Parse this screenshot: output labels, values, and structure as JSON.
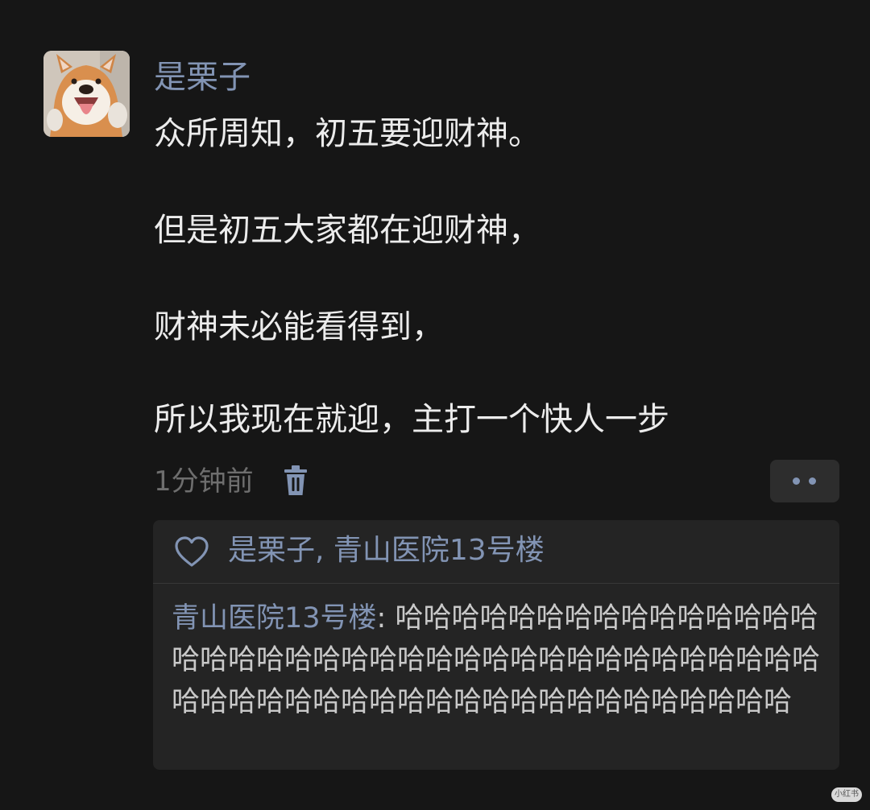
{
  "post": {
    "avatar_icon": "shiba-dog-avatar",
    "username": "是栗子",
    "lines": [
      "众所周知，初五要迎财神。",
      "但是初五大家都在迎财神，",
      "财神未必能看得到，",
      "所以我现在就迎，主打一个快人一步"
    ],
    "timestamp": "1分钟前",
    "delete_icon": "trash-icon",
    "more_icon": "more-dots-icon"
  },
  "interactions": {
    "like_icon": "heart-outline-icon",
    "likes_text": "是栗子, 青山医院13号楼",
    "comments": [
      {
        "author": "青山医院13号楼",
        "separator": ": ",
        "text": "哈哈哈哈哈哈哈哈哈哈哈哈哈哈哈哈哈哈哈哈哈哈哈哈哈哈哈哈哈哈哈哈哈哈哈哈哈哈哈哈哈哈哈哈哈哈哈哈哈哈哈哈哈哈哈哈哈哈哈哈"
      }
    ]
  },
  "watermark": "小红书",
  "colors": {
    "background": "#161616",
    "name_accent": "#8294b4",
    "text": "#ececec",
    "muted": "#6e6e6e",
    "panel": "#242424"
  }
}
